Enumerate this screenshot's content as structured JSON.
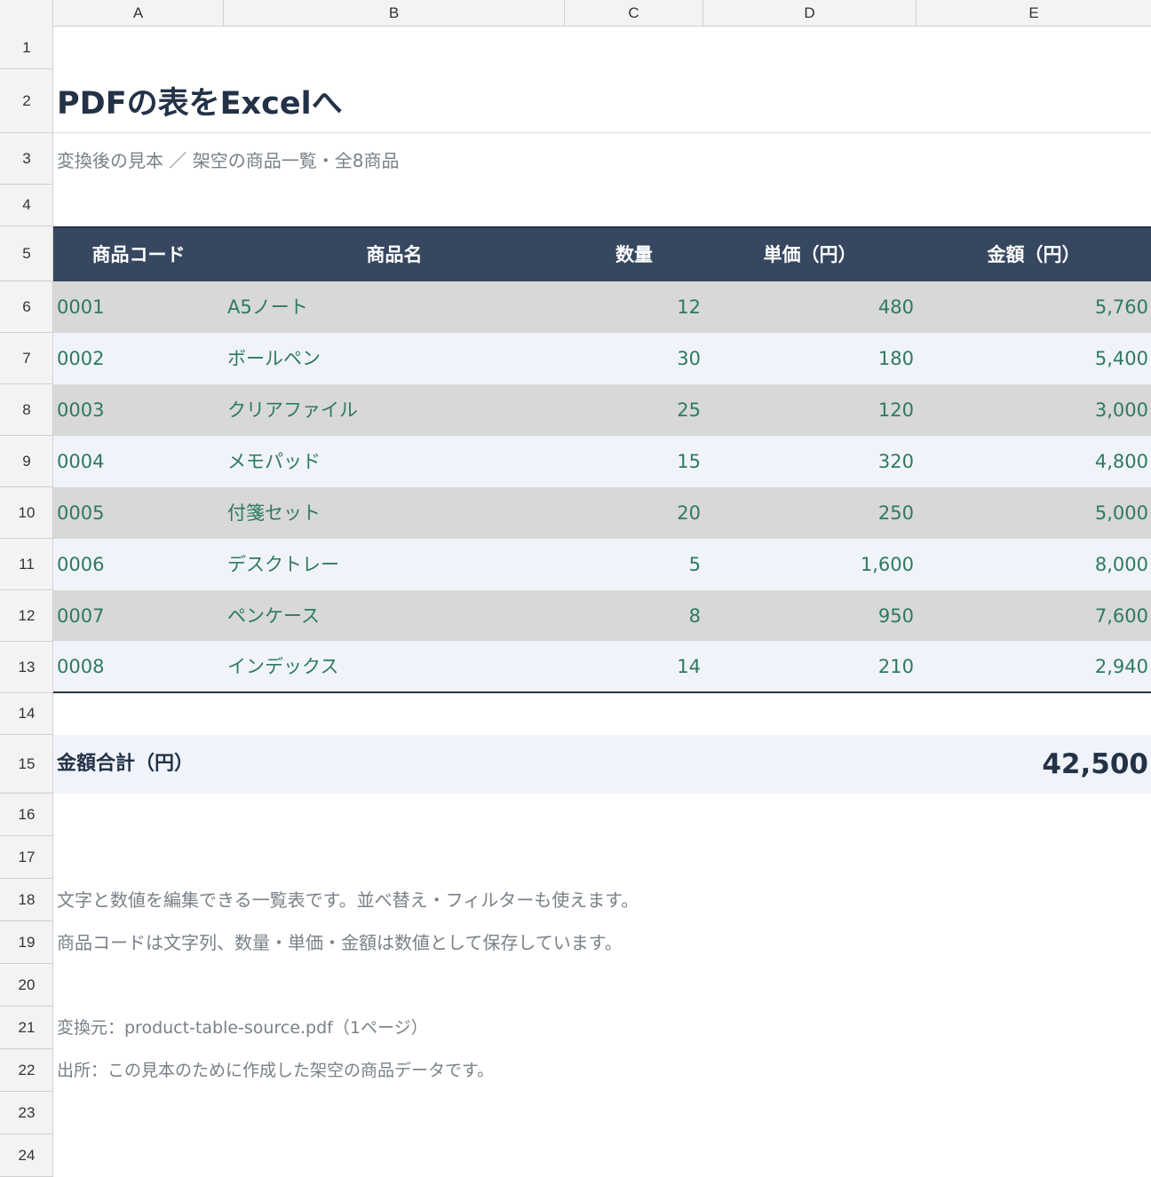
{
  "columns": [
    "A",
    "B",
    "C",
    "D",
    "E"
  ],
  "rows": [
    "1",
    "2",
    "3",
    "4",
    "5",
    "6",
    "7",
    "8",
    "9",
    "10",
    "11",
    "12",
    "13",
    "14",
    "15",
    "16",
    "17",
    "18",
    "19",
    "20",
    "21",
    "22",
    "23",
    "24"
  ],
  "title": "PDFの表をExcelへ",
  "subtitle": "変換後の見本 ／ 架空の商品一覧・全8商品",
  "table": {
    "headers": [
      "商品コード",
      "商品名",
      "数量",
      "単価（円）",
      "金額（円）"
    ],
    "rows": [
      {
        "code": "0001",
        "name": "A5ノート",
        "qty": "12",
        "price": "480",
        "amount": "5,760"
      },
      {
        "code": "0002",
        "name": "ボールペン",
        "qty": "30",
        "price": "180",
        "amount": "5,400"
      },
      {
        "code": "0003",
        "name": "クリアファイル",
        "qty": "25",
        "price": "120",
        "amount": "3,000"
      },
      {
        "code": "0004",
        "name": "メモパッド",
        "qty": "15",
        "price": "320",
        "amount": "4,800"
      },
      {
        "code": "0005",
        "name": "付箋セット",
        "qty": "20",
        "price": "250",
        "amount": "5,000"
      },
      {
        "code": "0006",
        "name": "デスクトレー",
        "qty": "5",
        "price": "1,600",
        "amount": "8,000"
      },
      {
        "code": "0007",
        "name": "ペンケース",
        "qty": "8",
        "price": "950",
        "amount": "7,600"
      },
      {
        "code": "0008",
        "name": "インデックス",
        "qty": "14",
        "price": "210",
        "amount": "2,940"
      }
    ]
  },
  "total": {
    "label": "金額合計（円）",
    "value": "42,500"
  },
  "notes": [
    "文字と数値を編集できる一覧表です。並べ替え・フィルターも使えます。",
    "商品コードは文字列、数量・単価・金額は数値として保存しています。"
  ],
  "source": "変換元：product-table-source.pdf（1ページ）",
  "credit": "出所：この見本のために作成した架空の商品データです。",
  "colors": {
    "header_bg": "#36475f",
    "title": "#233247",
    "text_green": "#2e7a5e",
    "row_odd": "#d8d8d8",
    "row_even": "#f0f4fa"
  }
}
